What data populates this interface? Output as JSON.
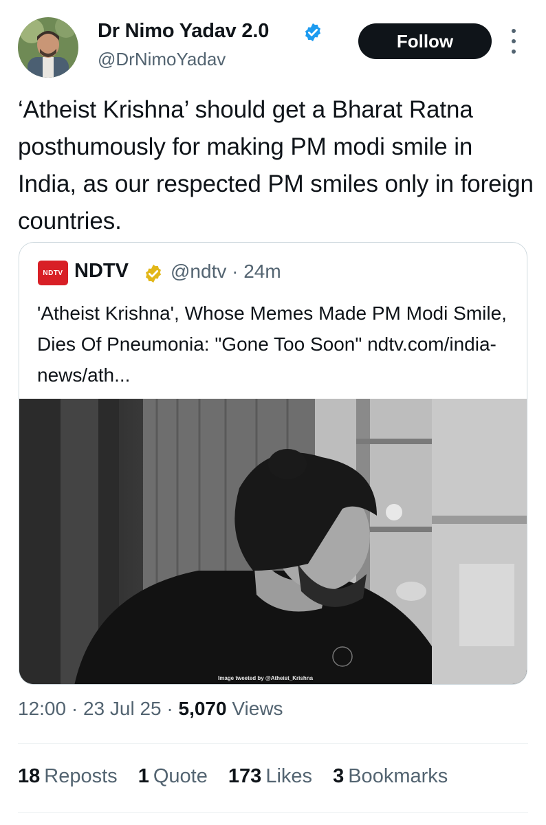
{
  "author": {
    "display_name": "Dr Nimo Yadav 2.0",
    "handle": "@DrNimoYadav",
    "verified_icon": "verified-badge-blue",
    "follow_label": "Follow"
  },
  "tweet": {
    "text": "‘Atheist Krishna’ should get a Bharat Ratna posthumously for making PM modi smile in India, as our respected PM smiles only in foreign countries."
  },
  "quote": {
    "logo_text": "NDTV",
    "name": "NDTV",
    "badge_icon": "verified-badge-gold",
    "handle_time": "@ndtv · 24m",
    "text": "'Atheist Krishna', Whose Memes Made PM Modi Smile, Dies Of Pneumonia: \"Gone Too Soon\" ndtv.com/india-news/ath...",
    "image_caption": "Image tweeted by @Atheist_Krishna"
  },
  "meta": {
    "time": "12:00",
    "sep1": " · ",
    "date": "23 Jul 25",
    "sep2": " · ",
    "views_count": "5,070",
    "views_label": " Views"
  },
  "stats": [
    {
      "count": "18",
      "label": "Reposts"
    },
    {
      "count": "1",
      "label": "Quote"
    },
    {
      "count": "173",
      "label": "Likes"
    },
    {
      "count": "3",
      "label": "Bookmarks"
    }
  ],
  "colors": {
    "text": "#0f1419",
    "secondary": "#536471",
    "verified_blue": "#1d9bf0",
    "verified_gold": "#e2b719",
    "ndtv_red": "#d81f26"
  }
}
